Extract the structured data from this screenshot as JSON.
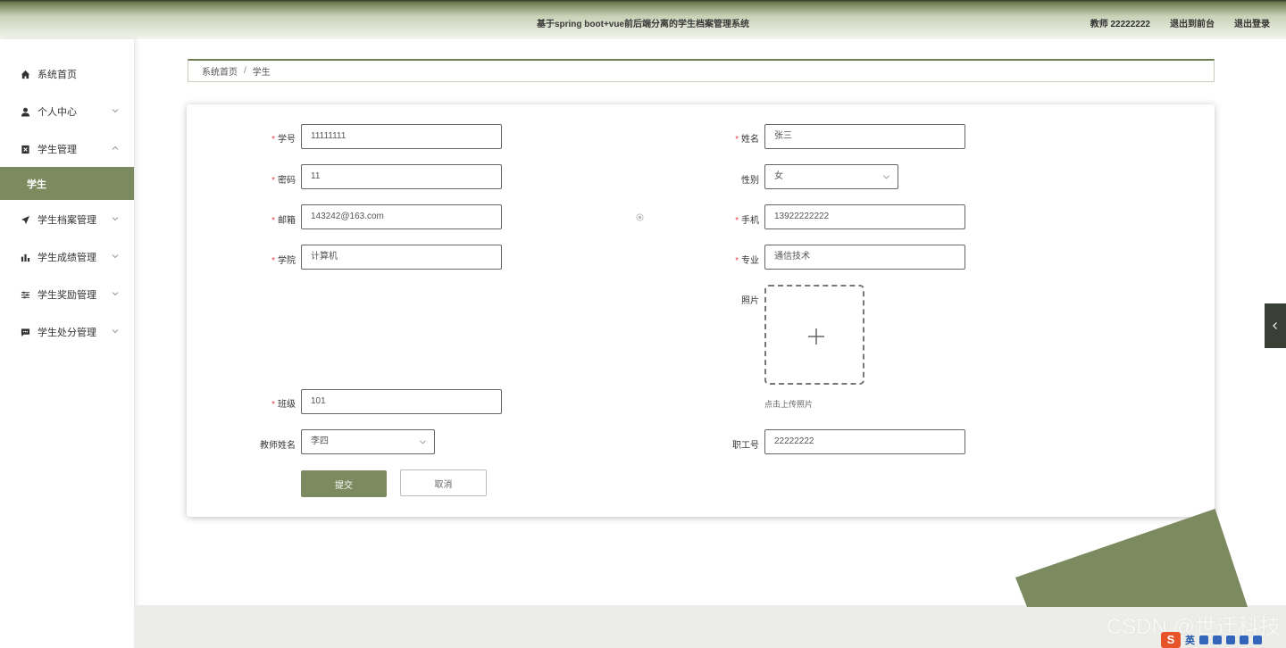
{
  "header": {
    "title": "基于spring boot+vue前后端分离的学生档案管理系统",
    "user": "教师 22222222",
    "back_to_front": "退出到前台",
    "logout": "退出登录"
  },
  "sidebar": {
    "items": [
      {
        "label": "系统首页",
        "icon": "home-icon"
      },
      {
        "label": "个人中心",
        "icon": "user-icon"
      },
      {
        "label": "学生管理",
        "icon": "badge-icon",
        "expanded": true
      },
      {
        "label": "学生档案管理",
        "icon": "send-icon"
      },
      {
        "label": "学生成绩管理",
        "icon": "bar-chart-icon"
      },
      {
        "label": "学生奖励管理",
        "icon": "sliders-icon"
      },
      {
        "label": "学生处分管理",
        "icon": "message-icon"
      }
    ],
    "sub_active": "学生"
  },
  "breadcrumb": {
    "home": "系统首页",
    "sep": "/",
    "current": "学生"
  },
  "form": {
    "student_no": {
      "label": "学号",
      "value": "11111111"
    },
    "name": {
      "label": "姓名",
      "value": "张三"
    },
    "password": {
      "label": "密码",
      "value": "11"
    },
    "gender": {
      "label": "性别",
      "value": "女"
    },
    "email": {
      "label": "邮箱",
      "value": "143242@163.com"
    },
    "phone": {
      "label": "手机",
      "value": "13922222222"
    },
    "college": {
      "label": "学院",
      "value": "计算机"
    },
    "major": {
      "label": "专业",
      "value": "通信技术"
    },
    "photo": {
      "label": "照片",
      "hint": "点击上传照片"
    },
    "class": {
      "label": "班级",
      "value": "101"
    },
    "teacher_name": {
      "label": "教师姓名",
      "value": "李四"
    },
    "staff_no": {
      "label": "职工号",
      "value": "22222222"
    },
    "submit": "提交",
    "cancel": "取消"
  },
  "watermark": "CSDN @世迁科技",
  "ime": {
    "lang": "英"
  },
  "colors": {
    "accent": "#7b8a5f",
    "required": "#e6424b"
  }
}
